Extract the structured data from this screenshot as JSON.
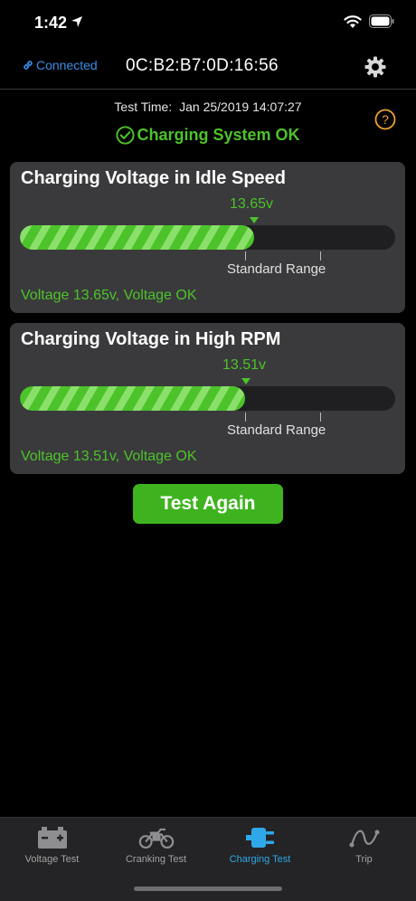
{
  "status_bar": {
    "time": "1:42"
  },
  "nav": {
    "connection_status": "Connected",
    "device_id": "0C:B2:B7:0D:16:56"
  },
  "test_info": {
    "time_label": "Test Time:",
    "time_value": "Jan 25/2019 14:07:27",
    "system_status": "Charging System OK"
  },
  "cards": [
    {
      "title": "Charging Voltage in Idle Speed",
      "value_label": "13.65v",
      "fill_fraction": 0.625,
      "range_label": "Standard Range",
      "result": "Voltage 13.65v, Voltage OK"
    },
    {
      "title": "Charging Voltage in High RPM",
      "value_label": "13.51v",
      "fill_fraction": 0.6,
      "range_label": "Standard Range",
      "result": "Voltage 13.51v, Voltage OK"
    }
  ],
  "actions": {
    "test_again": "Test Again"
  },
  "tabs": [
    {
      "label": "Voltage Test",
      "icon": "battery-icon"
    },
    {
      "label": "Cranking Test",
      "icon": "motorcycle-icon"
    },
    {
      "label": "Charging Test",
      "icon": "charging-plug-icon",
      "active": true
    },
    {
      "label": "Trip",
      "icon": "route-icon"
    }
  ],
  "colors": {
    "accent_green": "#4cc32a",
    "accent_blue": "#2fa8ea",
    "warning": "#f0a030"
  }
}
